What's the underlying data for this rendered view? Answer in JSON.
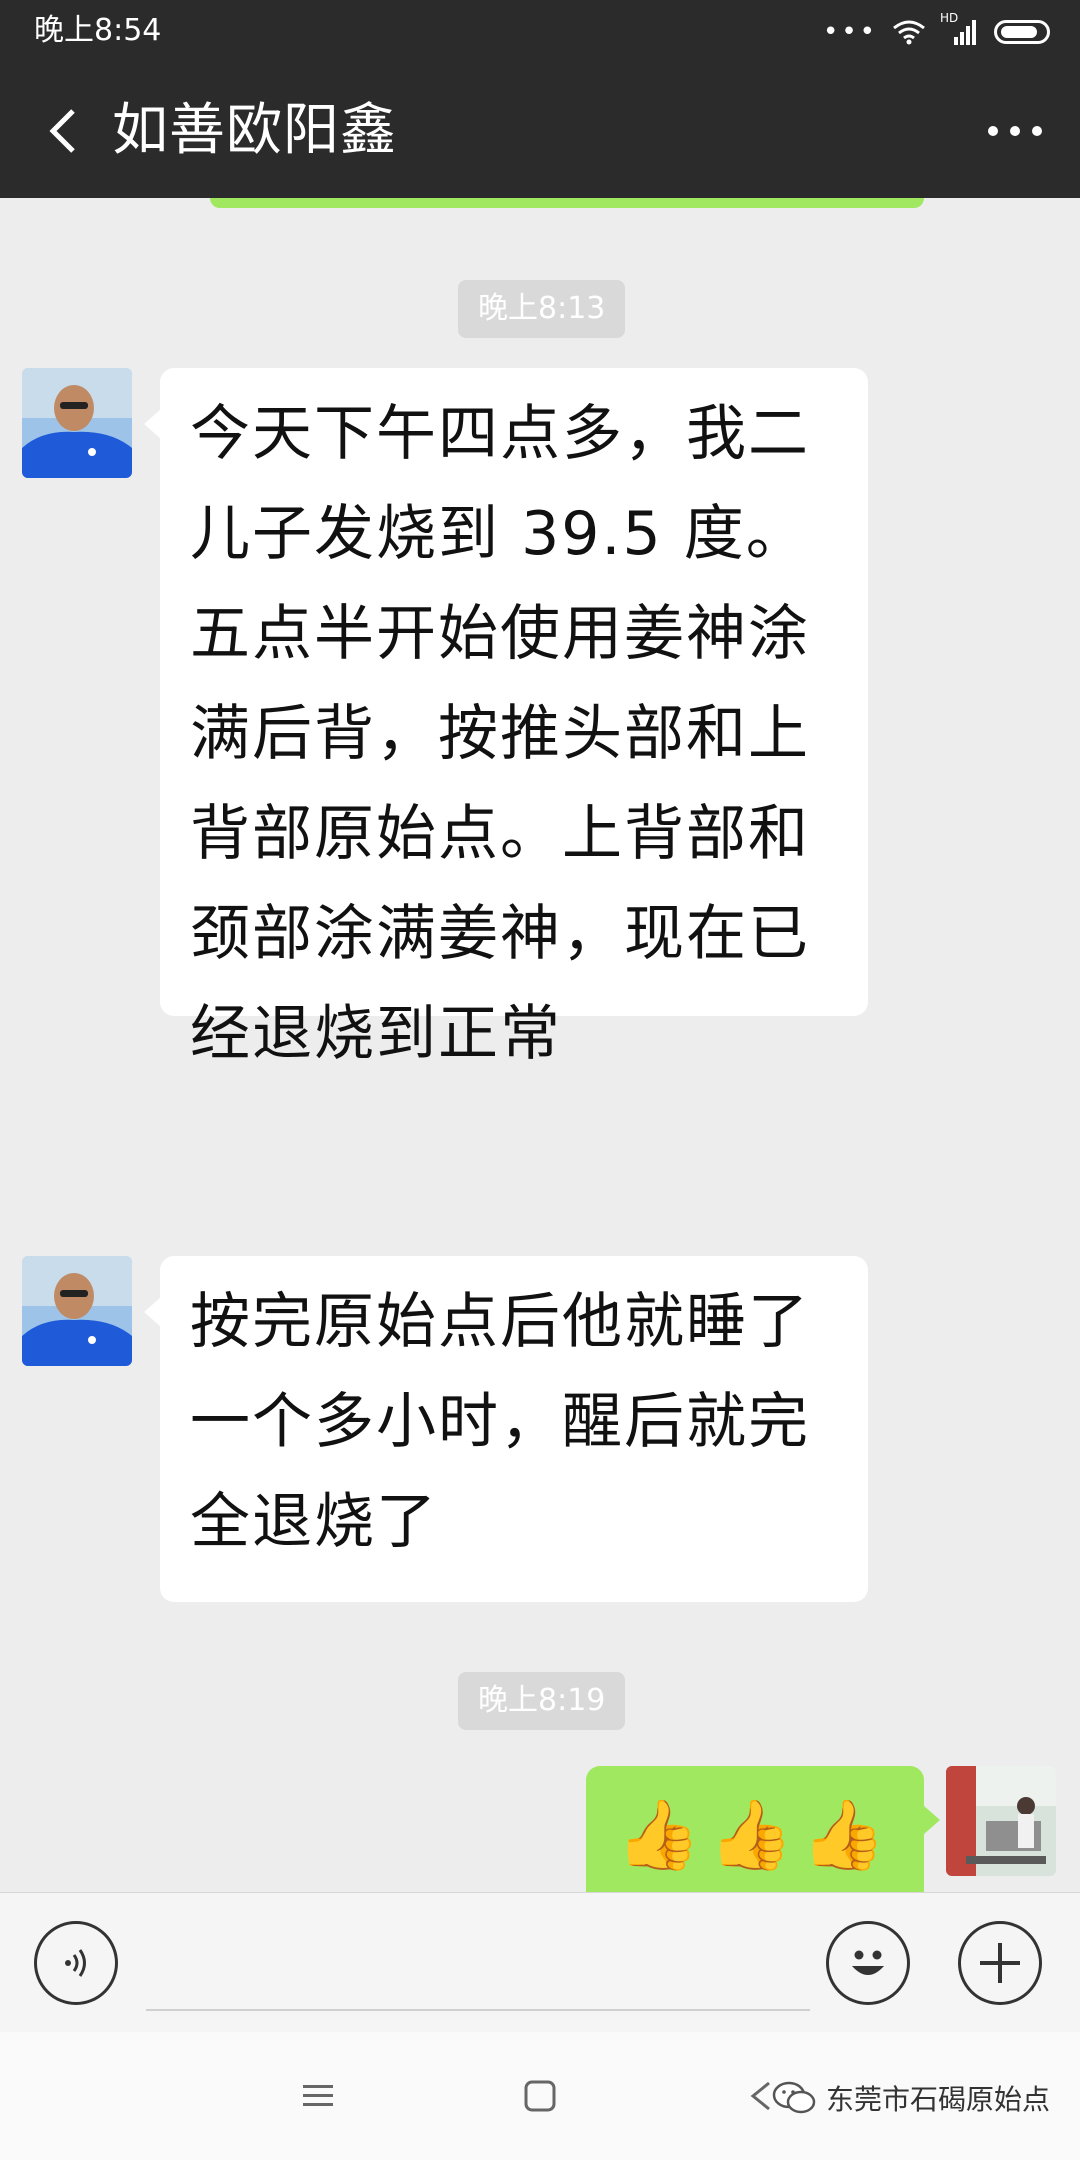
{
  "status_bar": {
    "time": "晚上8:54",
    "network": "HD"
  },
  "header": {
    "title": "如善欧阳鑫",
    "back_icon": "chevron-left-icon",
    "more_icon": "more-dots-icon"
  },
  "messages": [
    {
      "type": "time",
      "text": "晚上8:13"
    },
    {
      "type": "incoming",
      "text": "今天下午四点多，我二儿子发烧到 39.5 度。五点半开始使用姜神涂满后背，按推头部和上背部原始点。上背部和颈部涂满姜神，现在已经退烧到正常"
    },
    {
      "type": "incoming",
      "text": "按完原始点后他就睡了一个多小时，醒后就完全退烧了"
    },
    {
      "type": "time",
      "text": "晚上8:19"
    },
    {
      "type": "outgoing",
      "text": "👍👍👍"
    }
  ],
  "input_bar": {
    "voice_icon": "voice-icon",
    "emoji_icon": "emoji-icon",
    "plus_icon": "plus-icon",
    "text_value": ""
  },
  "nav_bar": {
    "menu_icon": "menu-icon",
    "home_icon": "home-square-icon",
    "back_icon": "back-triangle-icon"
  },
  "watermark": {
    "text": "东莞市石碣原始点"
  },
  "colors": {
    "header_bg": "#2b2b2b",
    "chat_bg": "#ededed",
    "outgoing_bubble": "#9fe85f",
    "incoming_bubble": "#ffffff",
    "time_chip": "#d9d9d9"
  }
}
